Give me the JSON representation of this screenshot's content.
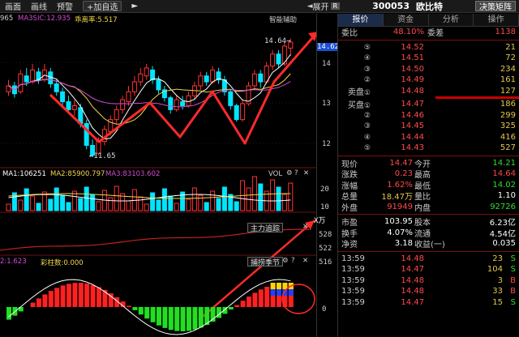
{
  "toolbar": {
    "items": [
      "画面",
      "画线",
      "预警"
    ],
    "add_button": "+加自选",
    "tool_icon": "chevron-right-icon",
    "expand_label": "展开",
    "badge": "R",
    "code": "300053",
    "name": "欧比特",
    "decide_button": "决策矩阵"
  },
  "main": {
    "indicator_prefix": "965",
    "ma1_label": "MA3SIC:12.935",
    "ma2_label": "乖离率:5.517",
    "assist_label": "智能辅助",
    "high_label": "14.64→",
    "low_label": "←11.65",
    "price_tag": "14.62",
    "y_ticks": [
      "14",
      "13",
      "12"
    ]
  },
  "vol": {
    "ma1": "MA1:106251",
    "ma2": "MA2:85900.797",
    "ma3": "MA3:83103.602",
    "name": "VOL",
    "y_ticks": [
      "20",
      "10"
    ],
    "unit": "X万"
  },
  "track": {
    "name": "主力追踪",
    "y_ticks": [
      "528",
      "522",
      "516"
    ]
  },
  "season": {
    "label_left": "2:1.623",
    "label_color": "彩柱数:0.000",
    "name": "捕捞季节",
    "y_ticks": [
      "0"
    ]
  },
  "quote": {
    "tabs": [
      "报价",
      "资金",
      "分析",
      "操作"
    ],
    "weibi_label": "委比",
    "weibi_val": "48.10%",
    "weicha_label": "委差",
    "weicha_val": "1138",
    "sell_label": "卖盘",
    "buy_label": "买盘",
    "asks": [
      {
        "n": "⑤",
        "price": "14.52",
        "vol": "21"
      },
      {
        "n": "④",
        "price": "14.51",
        "vol": "72"
      },
      {
        "n": "③",
        "price": "14.50",
        "vol": "234"
      },
      {
        "n": "②",
        "price": "14.49",
        "vol": "161"
      },
      {
        "n": "①",
        "price": "14.48",
        "vol": "127"
      }
    ],
    "bids": [
      {
        "n": "①",
        "price": "14.47",
        "vol": "186"
      },
      {
        "n": "②",
        "price": "14.46",
        "vol": "299"
      },
      {
        "n": "③",
        "price": "14.45",
        "vol": "325"
      },
      {
        "n": "④",
        "price": "14.44",
        "vol": "416"
      },
      {
        "n": "⑤",
        "price": "14.43",
        "vol": "527"
      }
    ],
    "stats": [
      {
        "l1": "现价",
        "v1": "14.47",
        "c1": "red",
        "l2": "今开",
        "v2": "14.21",
        "c2": "green"
      },
      {
        "l1": "涨跌",
        "v1": "0.23",
        "c1": "red",
        "l2": "最高",
        "v2": "14.64",
        "c2": "red"
      },
      {
        "l1": "涨幅",
        "v1": "1.62%",
        "c1": "red",
        "l2": "最低",
        "v2": "14.02",
        "c2": "green"
      },
      {
        "l1": "总量",
        "v1": "18.47万",
        "c1": "yellow",
        "l2": "量比",
        "v2": "1.10",
        "c2": "white"
      },
      {
        "l1": "外盘",
        "v1": "91949",
        "c1": "red",
        "l2": "内盘",
        "v2": "92726",
        "c2": "green"
      }
    ],
    "stats2": [
      {
        "l1": "市盈",
        "v1": "103.95",
        "c1": "white",
        "l2": "股本",
        "v2": "6.23亿",
        "c2": "white"
      },
      {
        "l1": "换手",
        "v1": "4.07%",
        "c1": "white",
        "l2": "流通",
        "v2": "4.54亿",
        "c2": "white"
      },
      {
        "l1": "净资",
        "v1": "3.18",
        "c1": "white",
        "l2": "收益(一)",
        "v2": "0.035",
        "c2": "white"
      }
    ],
    "ticks": [
      {
        "t": "13:59",
        "p": "14.48",
        "v": "23",
        "s": "S"
      },
      {
        "t": "13:59",
        "p": "14.47",
        "v": "104",
        "s": "S"
      },
      {
        "t": "13:59",
        "p": "14.48",
        "v": "3",
        "s": "B"
      },
      {
        "t": "13:59",
        "p": "14.48",
        "v": "33",
        "s": "B"
      },
      {
        "t": "13:59",
        "p": "14.47",
        "v": "15",
        "s": "S"
      }
    ]
  },
  "colors": {
    "up": "#ff3333",
    "down": "#00e5ff",
    "ma1": "#ffffff",
    "ma2": "#f2d64b",
    "ma3": "#d04cd0"
  }
}
